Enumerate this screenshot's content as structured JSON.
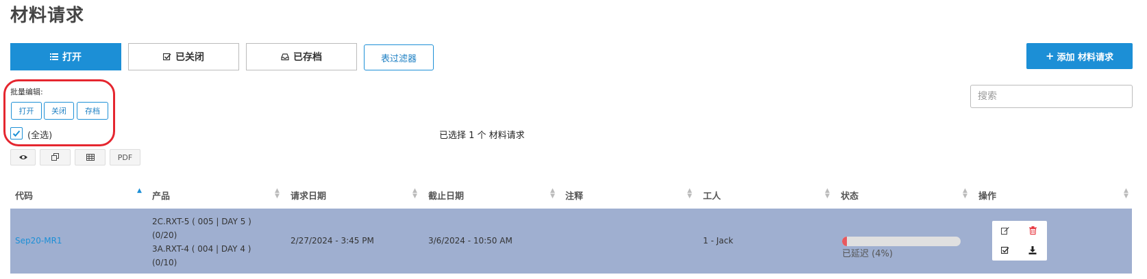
{
  "page": {
    "title": "材料请求"
  },
  "tabs": [
    {
      "label": "打开",
      "icon": "list-icon"
    },
    {
      "label": "已关闭",
      "icon": "check-square-icon"
    },
    {
      "label": "已存档",
      "icon": "inbox-icon"
    },
    {
      "label": "表过滤器"
    }
  ],
  "add_button": {
    "label": "添加 材料请求",
    "icon": "plus-icon"
  },
  "search": {
    "placeholder": "搜索",
    "value": ""
  },
  "bulk_edit": {
    "label": "批量编辑:",
    "buttons": [
      "打开",
      "关闭",
      "存档"
    ],
    "select_all_label": "(全选)",
    "select_all_checked": true
  },
  "selection_status": "已选择 1 个 材料请求",
  "view_buttons": [
    {
      "icon": "eye-icon"
    },
    {
      "icon": "copy-icon"
    },
    {
      "icon": "table-icon"
    },
    {
      "label": "PDF"
    }
  ],
  "table": {
    "columns": [
      "代码",
      "产品",
      "请求日期",
      "截止日期",
      "注释",
      "工人",
      "状态",
      "操作"
    ],
    "sorted_column": "代码",
    "rows": [
      {
        "code": "Sep20-MR1",
        "products": [
          "2C.RXT-5 ( 005 | DAY 5 )",
          "(0/20)",
          "3A.RXT-4 ( 004 | DAY 4 )",
          "(0/10)"
        ],
        "request_date": "2/27/2024 - 3:45 PM",
        "due_date": "3/6/2024 - 10:50 AM",
        "notes": "",
        "worker": "1 - Jack",
        "status_text": "已延迟 (4%)",
        "progress_percent": 4,
        "selected": true
      }
    ]
  },
  "colors": {
    "primary": "#1c8fd6",
    "selected_row": "#9fafd0",
    "progress_fill": "#e8595e",
    "annotation_circle": "#e5262f",
    "delete_icon": "#e5262f"
  }
}
